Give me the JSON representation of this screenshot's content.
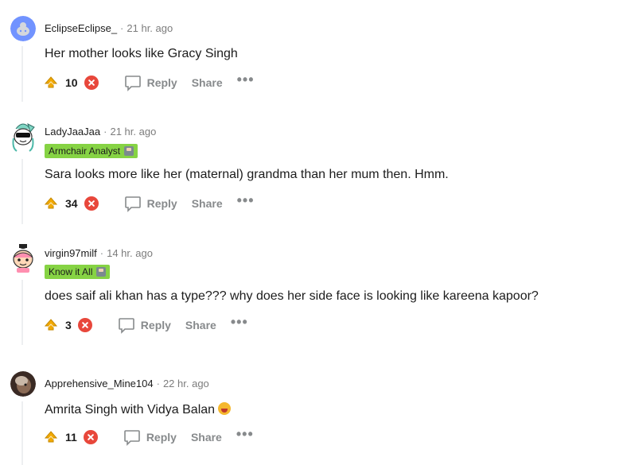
{
  "comments": [
    {
      "username": "EclipseEclipse_",
      "time": "21 hr. ago",
      "flair": null,
      "text": "Her mother looks like Gracy Singh",
      "score": "10",
      "reply_label": "Reply",
      "share_label": "Share",
      "more_label": "•••",
      "avatar": "default-snoo-avatar"
    },
    {
      "username": "LadyJaaJaa",
      "time": "21 hr. ago",
      "flair": "Armchair Analyst",
      "text": "Sara looks more like her (maternal) grandma than her mum then. Hmm.",
      "score": "34",
      "reply_label": "Reply",
      "share_label": "Share",
      "more_label": "•••",
      "avatar": "snoo-sunglasses-avatar"
    },
    {
      "username": "virgin97milf",
      "time": "14 hr. ago",
      "flair": "Know it All",
      "text": "does saif ali khan has a type??? why does her side face is looking like kareena kapoor?",
      "score": "3",
      "reply_label": "Reply",
      "share_label": "Share",
      "more_label": "•••",
      "avatar": "snoo-hat-avatar"
    },
    {
      "username": "Apprehensive_Mine104",
      "time": "22 hr. ago",
      "flair": null,
      "text": "Amrita Singh with Vidya Balan",
      "score": "11",
      "reply_label": "Reply",
      "share_label": "Share",
      "more_label": "•••",
      "avatar": "photo-avatar",
      "text_emoji": "crying-face-emoji"
    }
  ],
  "colors": {
    "upvote": "#f2a900",
    "downvote": "#e8473b",
    "flair": "#86d344",
    "meta": "#7c7c7c",
    "action": "#878a8c"
  }
}
